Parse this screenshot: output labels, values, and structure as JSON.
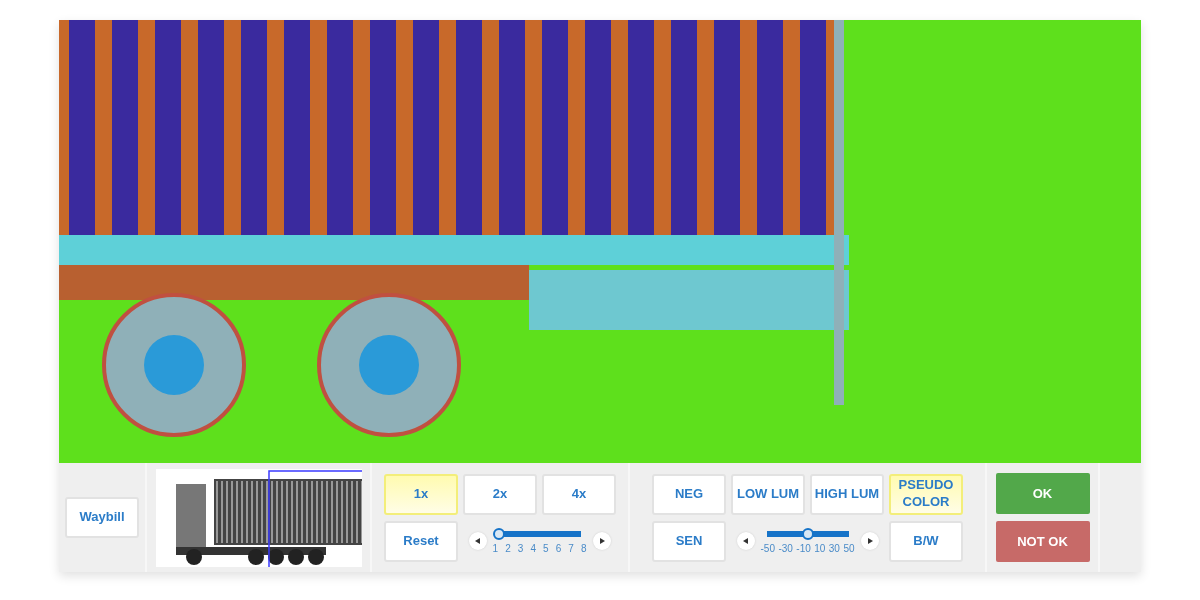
{
  "waybill": {
    "label": "Waybill"
  },
  "zoom": {
    "buttons": [
      {
        "label": "1x",
        "selected": true
      },
      {
        "label": "2x",
        "selected": false
      },
      {
        "label": "4x",
        "selected": false
      }
    ],
    "reset": "Reset",
    "slider": {
      "level": 0,
      "ticks": [
        "1",
        "2",
        "3",
        "4",
        "5",
        "6",
        "7",
        "8"
      ]
    }
  },
  "image_modes": {
    "buttons": [
      {
        "label": "NEG",
        "selected": false
      },
      {
        "label": "LOW LUM",
        "selected": false
      },
      {
        "label": "HIGH LUM",
        "selected": false
      },
      {
        "label": "PSEUDO COLOR",
        "selected": true
      }
    ],
    "sen": {
      "label": "SEN",
      "selected": false
    },
    "slider": {
      "level": 0.5,
      "ticks": [
        "-50",
        "-30",
        "-10",
        "10",
        "30",
        "50"
      ]
    },
    "bw": {
      "label": "B/W",
      "selected": false
    }
  },
  "decision": {
    "ok": "OK",
    "not_ok": "NOT OK"
  }
}
